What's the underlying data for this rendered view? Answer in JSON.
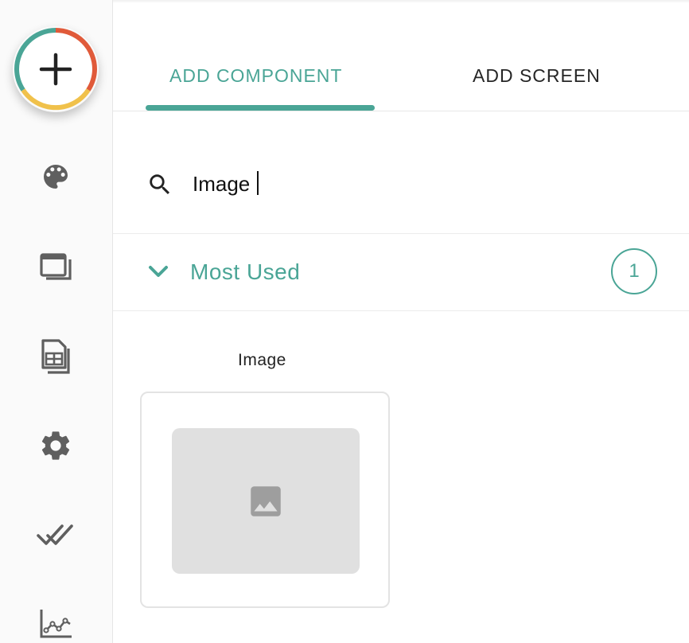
{
  "sidebar": {
    "add_button_icon": "plus-icon",
    "fab_colors": [
      "#e05a3a",
      "#f0c14b",
      "#4aa596"
    ],
    "items": [
      {
        "name": "theme",
        "icon": "palette-icon"
      },
      {
        "name": "screens",
        "icon": "screens-icon"
      },
      {
        "name": "database",
        "icon": "table-icon"
      },
      {
        "name": "settings",
        "icon": "gear-icon"
      },
      {
        "name": "publish",
        "icon": "double-check-icon"
      },
      {
        "name": "analytics",
        "icon": "chart-icon"
      }
    ]
  },
  "tabs": {
    "active_label": "ADD COMPONENT",
    "inactive_label": "ADD SCREEN"
  },
  "search": {
    "value": "Image",
    "icon": "search-icon"
  },
  "section": {
    "title": "Most Used",
    "count": "1",
    "icon": "chevron-down-icon"
  },
  "component": {
    "label": "Image",
    "icon": "image-icon"
  },
  "colors": {
    "accent": "#4aa596",
    "icon_gray": "#5f5f5f",
    "preview_bg": "#e0e0e0"
  }
}
